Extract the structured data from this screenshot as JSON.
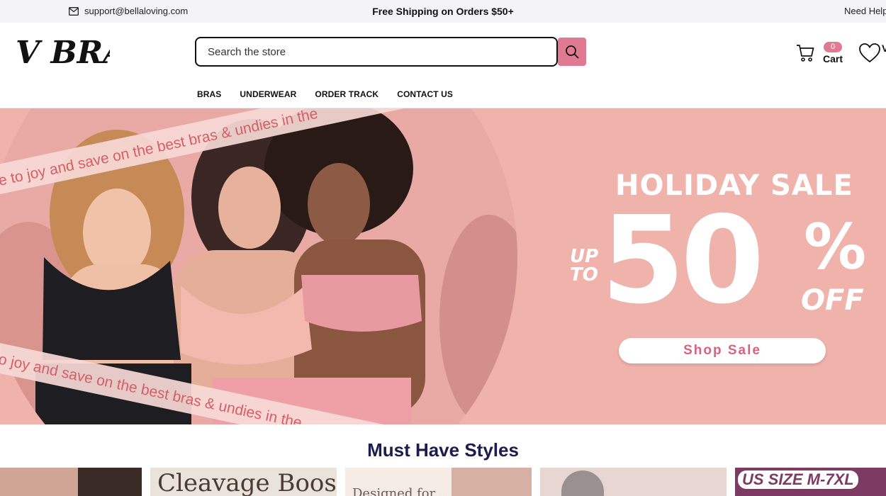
{
  "topbar": {
    "email": "support@bellaloving.com",
    "promo": "Free Shipping on Orders $50+",
    "help": "Need Help"
  },
  "header": {
    "logo_text": "V BRAS",
    "search_placeholder": "Search the store",
    "cart_count": "0",
    "cart_label": "Cart",
    "wish_tail": "V"
  },
  "nav": {
    "items": [
      "BRAS",
      "UNDERWEAR",
      "ORDER TRACK",
      "CONTACT US"
    ]
  },
  "hero": {
    "banner_top": "ue to joy and save on the best bras & undies in the",
    "banner_bottom": "o joy and save on the best bras & undies in the",
    "title": "HOLIDAY SALE",
    "up": "UP",
    "to": "TO",
    "percent": "50",
    "percent_sign": "%",
    "off": "OFF",
    "cta": "Shop Sale"
  },
  "section": {
    "title": "Must Have Styles"
  },
  "tiles": {
    "tile2_text": "Cleavage Boost",
    "tile3_text": "Designed for...",
    "tile5_text": "US SIZE M-7XL"
  },
  "colors": {
    "accent": "#e07a93",
    "hero_bg": "#f0b3ac",
    "navy": "#1c1c4e"
  }
}
